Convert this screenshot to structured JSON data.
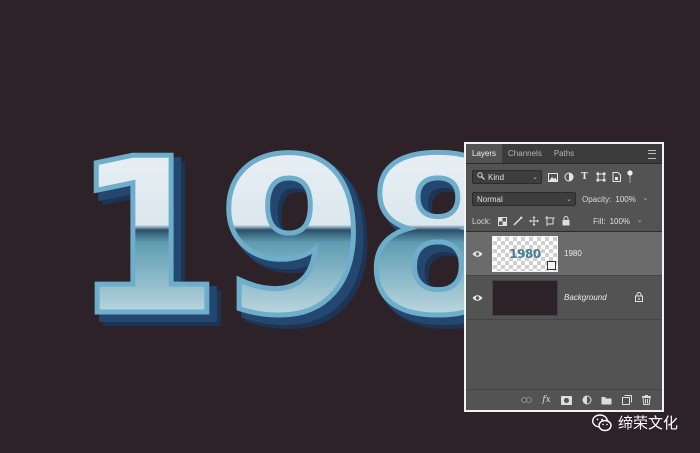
{
  "artwork": {
    "text": "1980",
    "colors": {
      "face_top": "#eef3f6",
      "face_bottom": "#5d99ac",
      "outline": "#7cb6ce",
      "extrude": "#1e3a5e",
      "background": "#2e2229"
    }
  },
  "layers_panel": {
    "tabs": [
      {
        "label": "Layers",
        "active": true
      },
      {
        "label": "Channels",
        "active": false
      },
      {
        "label": "Paths",
        "active": false
      }
    ],
    "filter": {
      "label": "Kind",
      "icons": [
        "image-filter-icon",
        "adjustment-filter-icon",
        "type-filter-icon",
        "shape-filter-icon",
        "smart-object-filter-icon"
      ]
    },
    "blend_mode": "Normal",
    "opacity": {
      "label": "Opacity:",
      "value": "100%"
    },
    "lock": {
      "label": "Lock:"
    },
    "fill": {
      "label": "Fill:",
      "value": "100%"
    },
    "layers": [
      {
        "name": "1980",
        "thumbnail_text": "1980",
        "visible": true,
        "selected": true,
        "smart_object": true
      },
      {
        "name": "Background",
        "visible": true,
        "selected": false,
        "locked": true
      }
    ],
    "bottom_icons": [
      "link-icon",
      "fx-icon",
      "mask-icon",
      "adjustment-icon",
      "folder-icon",
      "new-layer-icon",
      "trash-icon"
    ],
    "fx_label": "fx"
  },
  "watermark": {
    "text": "缔荣文化"
  }
}
